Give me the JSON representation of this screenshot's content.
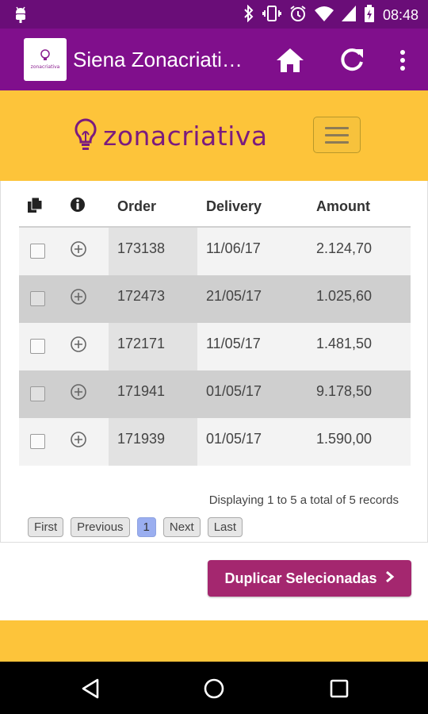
{
  "status_bar": {
    "time": "08:48",
    "icons": [
      "android-debug-icon",
      "bluetooth-icon",
      "vibrate-icon",
      "alarm-icon",
      "wifi-icon",
      "signal-icon",
      "battery-icon"
    ]
  },
  "app_bar": {
    "title": "Siena Zonacriati…",
    "logo_text": "zonacriativa",
    "actions": [
      "home-icon",
      "refresh-icon",
      "more-vert-icon"
    ],
    "color": "#800f8c"
  },
  "banner": {
    "logo_text": "zonacriativa",
    "menu_icon": "hamburger-icon",
    "color": "#fdc43a"
  },
  "table": {
    "headers": {
      "copy_icon": "copy-icon",
      "info_icon": "info-icon",
      "order": "Order",
      "delivery": "Delivery",
      "amount": "Amount"
    },
    "rows": [
      {
        "order": "173138",
        "delivery": "11/06/17",
        "amount": "2.124,70"
      },
      {
        "order": "172473",
        "delivery": "21/05/17",
        "amount": "1.025,60"
      },
      {
        "order": "172171",
        "delivery": "11/05/17",
        "amount": "1.481,50"
      },
      {
        "order": "171941",
        "delivery": "01/05/17",
        "amount": "9.178,50"
      },
      {
        "order": "171939",
        "delivery": "01/05/17",
        "amount": "1.590,00"
      }
    ],
    "records_text": "Displaying 1 to 5 a total of 5 records"
  },
  "pagination": {
    "first": "First",
    "previous": "Previous",
    "current": "1",
    "next": "Next",
    "last": "Last"
  },
  "actions": {
    "duplicate_label": "Duplicar Selecionadas",
    "duplicate_color": "#a4276f"
  }
}
